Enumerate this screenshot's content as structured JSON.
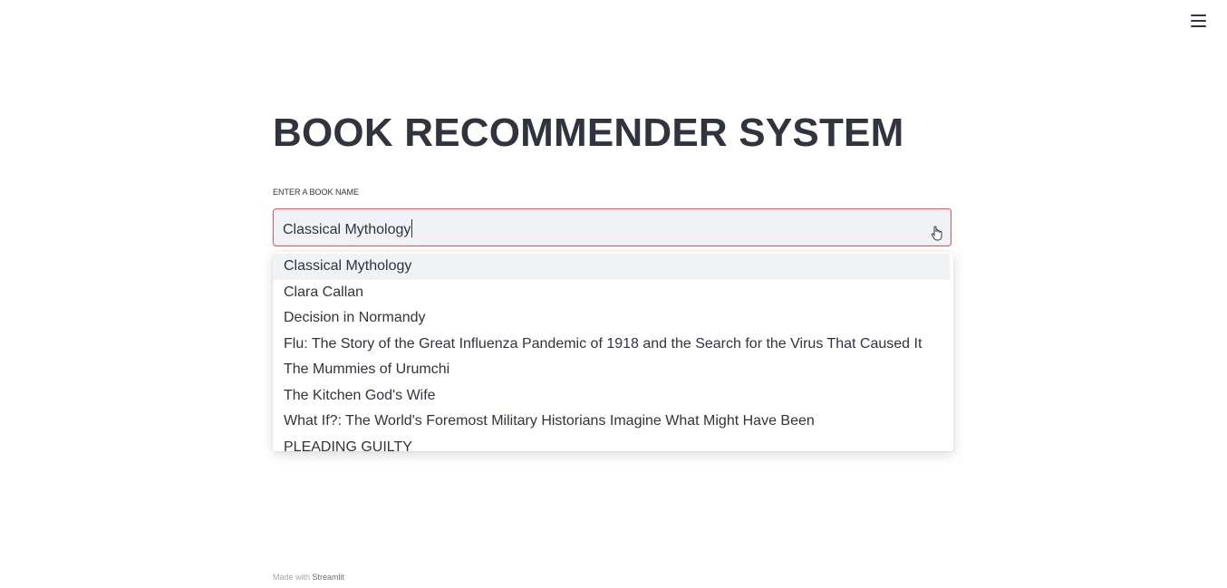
{
  "header": {
    "menu_icon": "hamburger-menu-icon"
  },
  "main": {
    "title": "BOOK RECOMMENDER SYSTEM",
    "select": {
      "label": "ENTER A BOOK NAME",
      "value": "Classical Mythology",
      "focus_border_color": "#ff4b4b",
      "options": [
        "Classical Mythology",
        "Clara Callan",
        "Decision in Normandy",
        "Flu: The Story of the Great Influenza Pandemic of 1918 and the Search for the Virus That Caused It",
        "The Mummies of Urumchi",
        "The Kitchen God's Wife",
        "What If?: The World's Foremost Military Historians Imagine What Might Have Been",
        "PLEADING GUILTY"
      ],
      "highlighted_option": "Classical Mythology"
    }
  },
  "footer": {
    "prefix": "Made with",
    "brand": "Streamlit"
  }
}
